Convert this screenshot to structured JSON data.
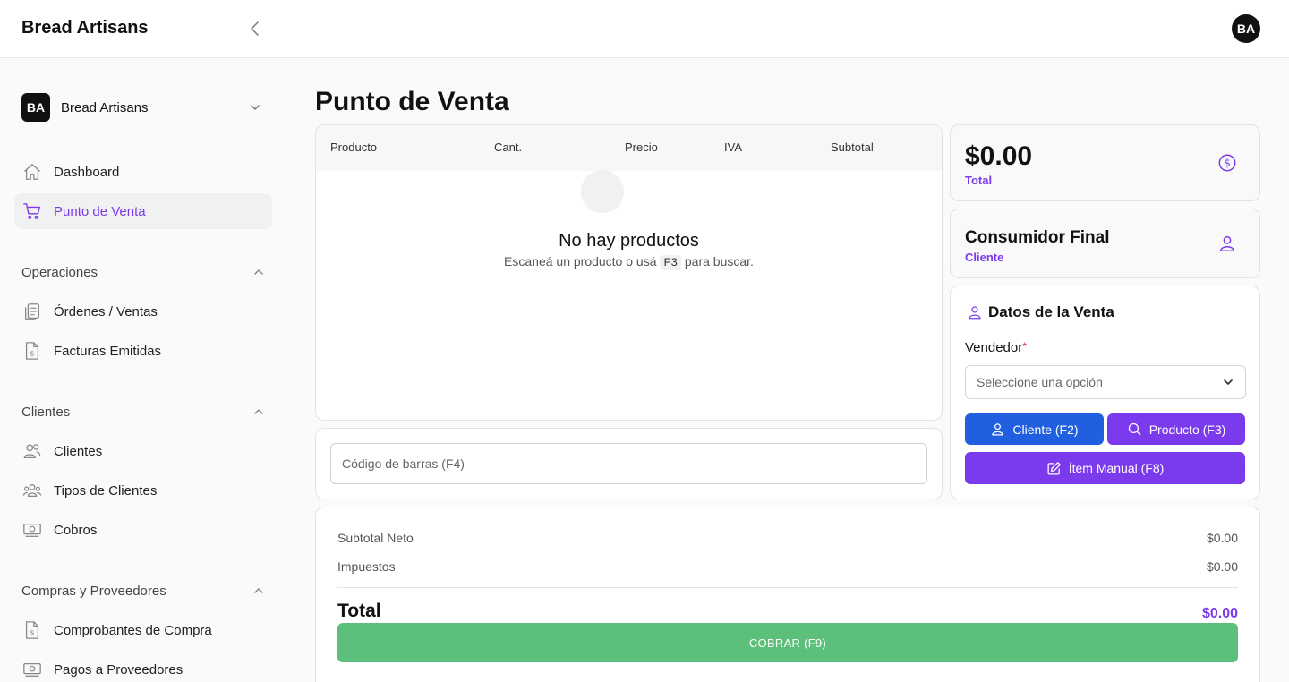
{
  "header": {
    "brand": "Bread Artisans",
    "avatar_initials": "BA"
  },
  "sidebar": {
    "org": {
      "initials": "BA",
      "name": "Bread Artisans"
    },
    "top_items": [
      {
        "label": "Dashboard",
        "icon": "home-icon"
      },
      {
        "label": "Punto de Venta",
        "icon": "cart-icon",
        "active": true
      }
    ],
    "sections": [
      {
        "title": "Operaciones",
        "items": [
          {
            "label": "Órdenes / Ventas",
            "icon": "clipboard-icon"
          },
          {
            "label": "Facturas Emitidas",
            "icon": "invoice-dollar-icon"
          }
        ]
      },
      {
        "title": "Clientes",
        "items": [
          {
            "label": "Clientes",
            "icon": "users-icon"
          },
          {
            "label": "Tipos de Clientes",
            "icon": "user-group-icon"
          },
          {
            "label": "Cobros",
            "icon": "cash-icon"
          }
        ]
      },
      {
        "title": "Compras y Proveedores",
        "items": [
          {
            "label": "Comprobantes de Compra",
            "icon": "invoice-dollar-icon"
          },
          {
            "label": "Pagos a Proveedores",
            "icon": "cash-icon"
          }
        ]
      }
    ]
  },
  "main": {
    "title": "Punto de Venta",
    "table": {
      "columns": [
        "Producto",
        "Cant.",
        "Precio",
        "IVA",
        "Subtotal"
      ],
      "empty_title": "No hay productos",
      "empty_sub_before": "Escaneá un producto o usá",
      "empty_sub_key": "F3",
      "empty_sub_after": "para buscar."
    },
    "barcode": {
      "placeholder": "Código de barras (F4)"
    },
    "total_card": {
      "value": "$0.00",
      "label": "Total"
    },
    "client_card": {
      "name": "Consumidor Final",
      "label": "Cliente"
    },
    "sale": {
      "title": "Datos de la Venta",
      "vendor_label": "Vendedor",
      "required_mark": "*",
      "vendor_placeholder": "Seleccione una opción",
      "client_button": "Cliente (F2)",
      "product_button": "Producto (F3)",
      "manual_button": "Ítem Manual (F8)"
    },
    "summary": {
      "subtotal_label": "Subtotal Neto",
      "subtotal_value": "$0.00",
      "tax_label": "Impuestos",
      "tax_value": "$0.00",
      "total_label": "Total",
      "total_value": "$0.00",
      "pay_button": "COBRAR (F9)"
    }
  },
  "colors": {
    "accent": "#7c3aed",
    "blue": "#1f5fe0",
    "pay": "#5cbf7a"
  }
}
